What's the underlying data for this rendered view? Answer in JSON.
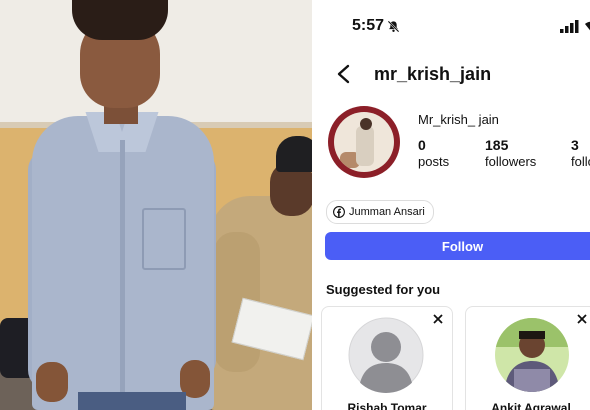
{
  "status_bar": {
    "time": "5:57"
  },
  "profile": {
    "username": "mr_krish_jain",
    "display_name": "Mr_krish_ jain",
    "stats": [
      {
        "value": "0",
        "label": "posts"
      },
      {
        "value": "185",
        "label": "followers"
      },
      {
        "value": "3",
        "label": "following"
      }
    ],
    "mutual": "Jumman Ansari",
    "follow_label": "Follow"
  },
  "suggested": {
    "title": "Suggested for you",
    "cards": [
      {
        "name": "Rishab Tomar",
        "avatar": "default-avatar-icon"
      },
      {
        "name": "Ankit Agrawal",
        "avatar": "photo-avatar"
      }
    ]
  },
  "colors": {
    "follow_button": "#4b5ef6",
    "avatar_ring": "#8c1f28"
  }
}
